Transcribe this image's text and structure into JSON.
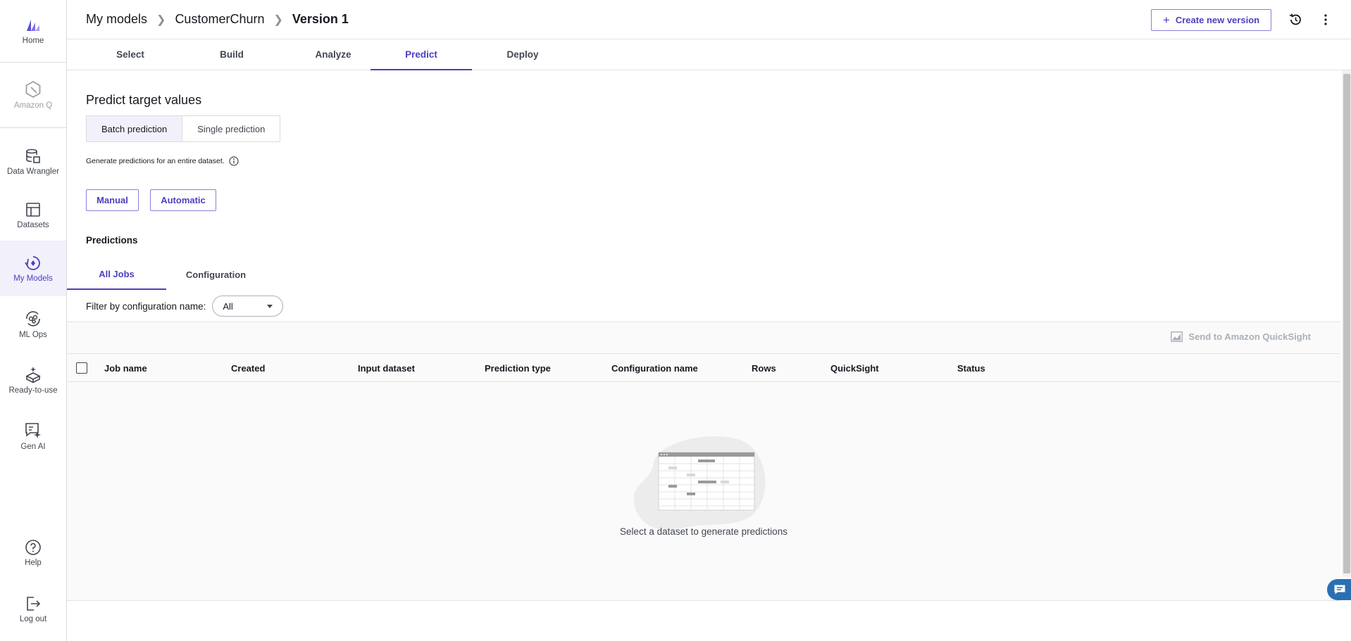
{
  "sidebar": {
    "items": [
      {
        "label": "Home"
      },
      {
        "label": "Amazon Q"
      },
      {
        "label": "Data Wrangler"
      },
      {
        "label": "Datasets"
      },
      {
        "label": "My Models"
      },
      {
        "label": "ML Ops"
      },
      {
        "label": "Ready-to-use"
      },
      {
        "label": "Gen AI"
      },
      {
        "label": "Help"
      },
      {
        "label": "Log out"
      }
    ]
  },
  "header": {
    "breadcrumb": [
      "My models",
      "CustomerChurn",
      "Version 1"
    ],
    "create_label": "Create new version"
  },
  "tabs": [
    "Select",
    "Build",
    "Analyze",
    "Predict",
    "Deploy"
  ],
  "main": {
    "title": "Predict target values",
    "segments": [
      "Batch prediction",
      "Single prediction"
    ],
    "description": "Generate predictions for an entire dataset.",
    "manual_label": "Manual",
    "automatic_label": "Automatic",
    "section_title": "Predictions",
    "subtabs": [
      "All Jobs",
      "Configuration"
    ],
    "filter_label": "Filter by configuration name:",
    "filter_value": "All",
    "quicksight_label": "Send to Amazon QuickSight",
    "columns": [
      "Job name",
      "Created",
      "Input dataset",
      "Prediction type",
      "Configuration name",
      "Rows",
      "QuickSight",
      "Status"
    ],
    "empty_message": "Select a dataset to generate predictions"
  },
  "colors": {
    "accent": "#4b3fbf",
    "active_bg": "#f1f0fb",
    "chat": "#2b6fb3"
  }
}
